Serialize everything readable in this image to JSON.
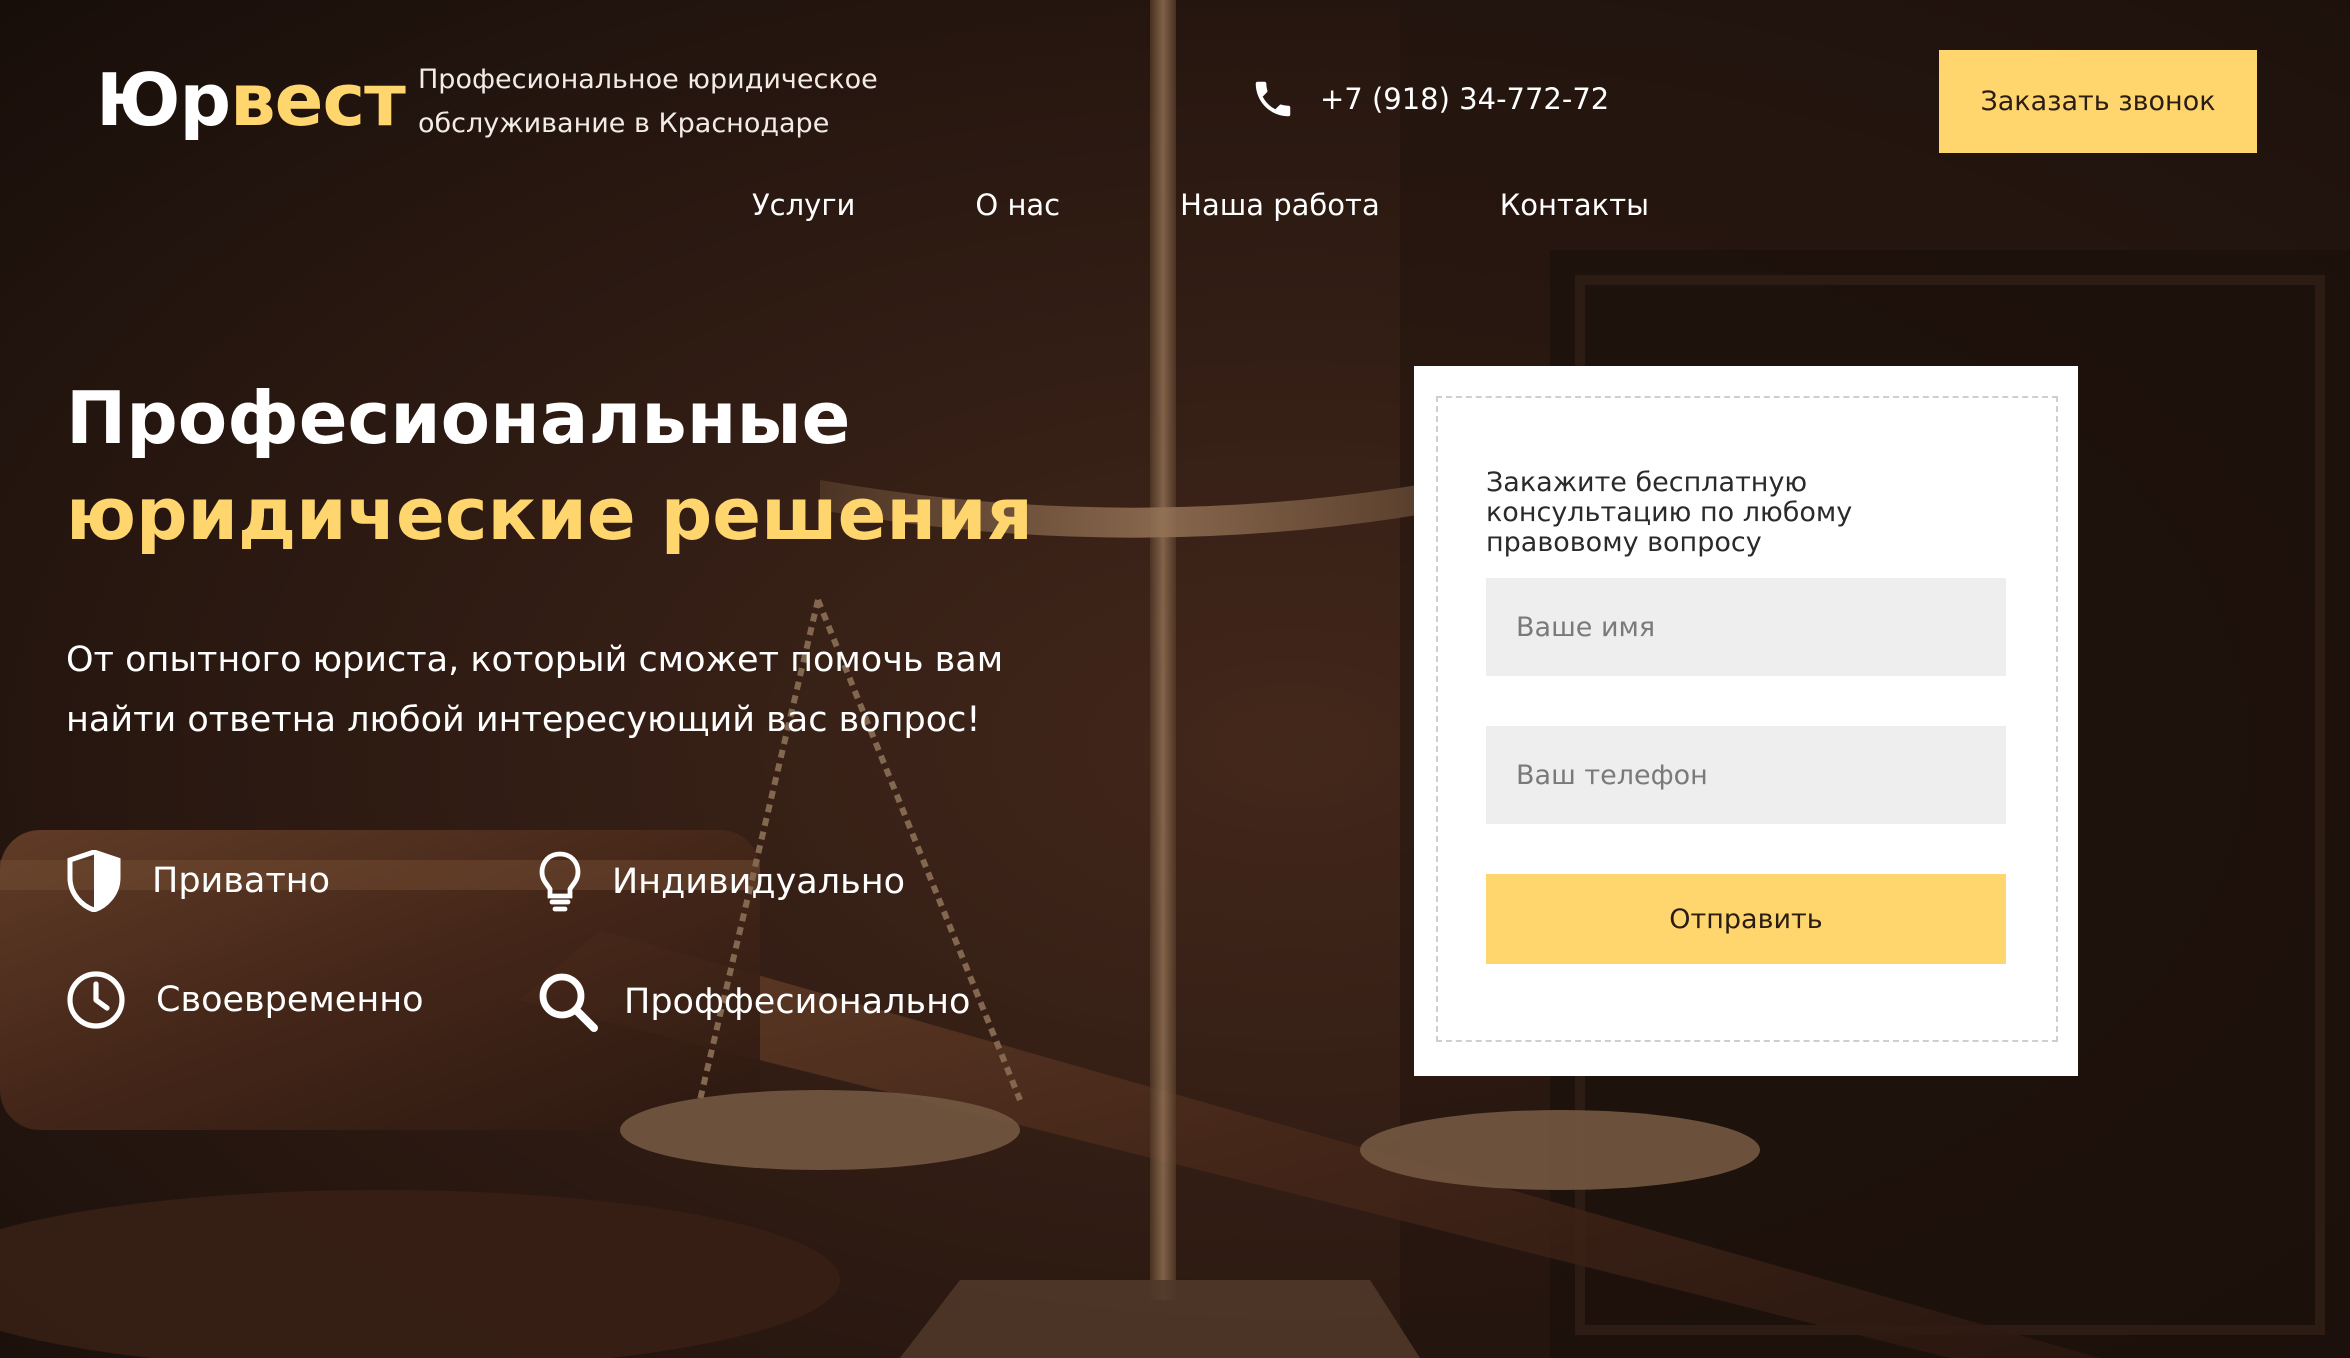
{
  "header": {
    "logo_part1": "Юр",
    "logo_part2": "вест",
    "tagline": "Професиональное юридическое обслуживание в Краснодаре",
    "phone": "+7 (918) 34-772-72",
    "callback_label": "Заказать звонок"
  },
  "nav": {
    "items": [
      "Услуги",
      "О нас",
      "Наша работа",
      "Контакты"
    ]
  },
  "hero": {
    "title_line1": "Професиональные",
    "title_line2": "юридические решения",
    "subtitle": "От опытного юриста, который сможет помочь вам найти ответна любой интересующий вас вопрос!",
    "features": [
      {
        "label": "Приватно",
        "icon": "shield-icon"
      },
      {
        "label": "Индивидуально",
        "icon": "lightbulb-icon"
      },
      {
        "label": "Своевременно",
        "icon": "clock-icon"
      },
      {
        "label": "Проффесионально",
        "icon": "search-icon"
      }
    ]
  },
  "form": {
    "heading": "Закажите бесплатную консультацию по любому правовому вопросу",
    "name_placeholder": "Ваше имя",
    "phone_placeholder": "Ваш телефон",
    "submit_label": "Отправить"
  },
  "colors": {
    "accent": "#ffd56e",
    "background_dark": "#2a1a12",
    "text_light": "#ffffff"
  }
}
